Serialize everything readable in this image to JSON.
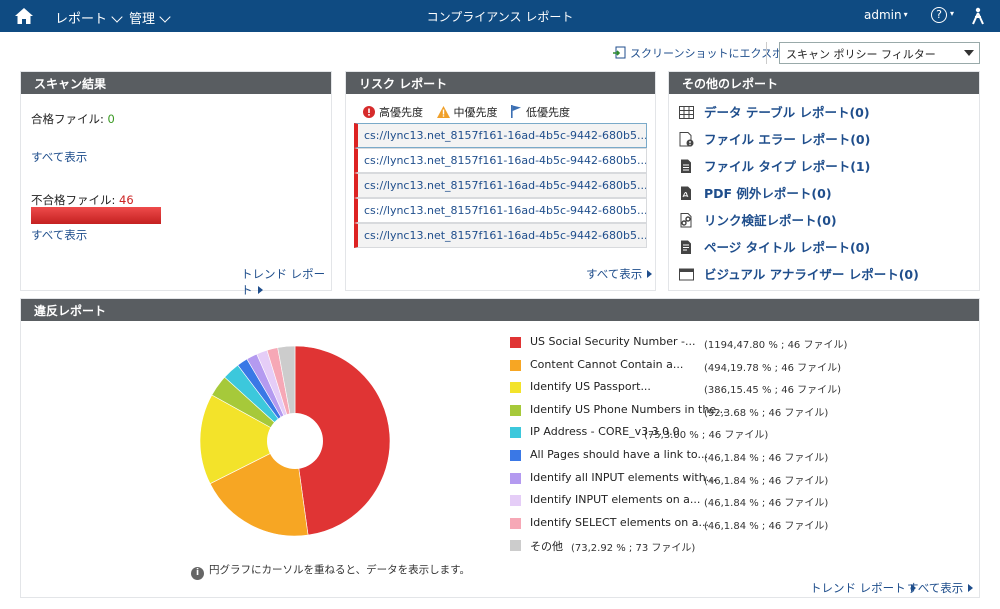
{
  "topbar": {
    "reports_menu": "レポート",
    "admin_menu": "管理",
    "title": "コンプライアンス レポート",
    "user": "admin",
    "help": "?"
  },
  "actions": {
    "export": "スクリーンショットにエクスポート",
    "filter_selected": "スキャン ポリシー フィルター"
  },
  "scan": {
    "title": "スキャン結果",
    "pass_label": "合格ファイル:",
    "pass_count": "0",
    "show_all": "すべて表示",
    "fail_label": "不合格ファイル:",
    "fail_count": "46",
    "show_all2": "すべて表示",
    "trend": "トレンド レポート"
  },
  "risk": {
    "title": "リスク レポート",
    "legend": {
      "high": "高優先度",
      "medium": "中優先度",
      "low": "低優先度"
    },
    "items": [
      "cs://lync13.net_8157f161-16ad-4b5c-9442-680b5...",
      "cs://lync13.net_8157f161-16ad-4b5c-9442-680b5...",
      "cs://lync13.net_8157f161-16ad-4b5c-9442-680b5...",
      "cs://lync13.net_8157f161-16ad-4b5c-9442-680b5...",
      "cs://lync13.net_8157f161-16ad-4b5c-9442-680b5..."
    ],
    "show_all": "すべて表示"
  },
  "other": {
    "title": "その他のレポート",
    "items": [
      {
        "label": "データ テーブル レポート(0)",
        "icon": "table-icon"
      },
      {
        "label": "ファイル エラー レポート(0)",
        "icon": "file-error-icon"
      },
      {
        "label": "ファイル タイプ レポート(1)",
        "icon": "file-type-icon"
      },
      {
        "label": "PDF 例外レポート(0)",
        "icon": "pdf-icon"
      },
      {
        "label": "リンク検証レポート(0)",
        "icon": "link-check-icon"
      },
      {
        "label": "ページ タイトル レポート(0)",
        "icon": "page-title-icon"
      },
      {
        "label": "ビジュアル アナライザー レポート(0)",
        "icon": "visual-analyzer-icon"
      }
    ]
  },
  "violation": {
    "title": "違反レポート",
    "note": "円グラフにカーソルを重ねると、データを表示します。",
    "trend": "トレンド レポート",
    "show_all": "すべて表示"
  },
  "chart_data": {
    "type": "pie",
    "categories": [
      "US Social Security Number -...",
      "Content Cannot Contain a...",
      "Identify US Passport...",
      "Identify US Phone Numbers in the...",
      "IP Address - CORE_v3.3.0.0",
      "All Pages should have a link to...",
      "Identify all INPUT elements with...",
      "Identify INPUT elements on a...",
      "Identify SELECT elements on a...",
      "その他"
    ],
    "values": [
      47.8,
      19.78,
      15.45,
      3.68,
      3.0,
      1.84,
      1.84,
      1.84,
      1.84,
      2.92
    ],
    "stats": [
      "(1194,47.80 % ; 46 ファイル)",
      "(494,19.78 % ; 46 ファイル)",
      "(386,15.45 % ; 46 ファイル)",
      "(92,3.68 % ; 46 ファイル)",
      "(75,3.00 % ; 46 ファイル)",
      "(46,1.84 % ; 46 ファイル)",
      "(46,1.84 % ; 46 ファイル)",
      "(46,1.84 % ; 46 ファイル)",
      "(46,1.84 % ; 46 ファイル)",
      "(73,2.92 % ; 73 ファイル)"
    ],
    "colors": [
      "#e03434",
      "#f7a623",
      "#f3e32a",
      "#a6c93a",
      "#3cc8dc",
      "#3a78e6",
      "#b49af0",
      "#e5cdf7",
      "#f6a8b6",
      "#cccccc"
    ]
  }
}
